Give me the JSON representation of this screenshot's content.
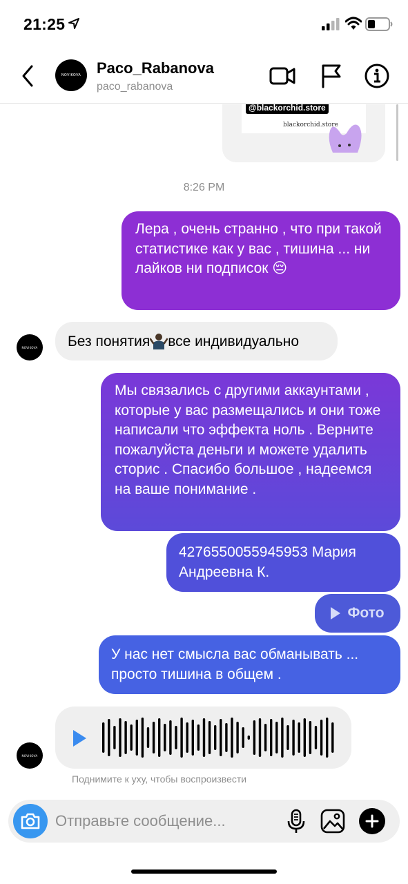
{
  "status_bar": {
    "time": "21:25"
  },
  "header": {
    "display_name": "Paco_Rabanova",
    "username": "paco_rabanova",
    "avatar_text": "NOVIKOVA"
  },
  "story_preview": {
    "tag": "@blackorchid.store",
    "caption": "blackorchid.store"
  },
  "timestamp": "8:26 PM",
  "messages": [
    {
      "from": "me",
      "text": "Лера , очень странно , что при такой статистике как у вас , тишина ... ни лайков ни подписок 😔"
    },
    {
      "from": "them",
      "text_before": "Без понятия",
      "text_after": "все индивидуально"
    },
    {
      "from": "me",
      "text": "Мы связались с другими аккаунтами , которые у вас размещались и они тоже написали что эффекта ноль . Верните пожалуйста деньги и можете удалить сторис . Спасибо большое , надеемся на ваше понимание ."
    },
    {
      "from": "me",
      "text": "4276550055945953 Мария Андреевна К."
    },
    {
      "from": "me",
      "type": "photo",
      "label": "Фото"
    },
    {
      "from": "me",
      "text": "У нас нет смысла вас обманывать ... просто тишина в общем ."
    },
    {
      "from": "them",
      "type": "voice"
    }
  ],
  "voice_hint": "Поднимите к уху, чтобы воспроизвести",
  "composer": {
    "placeholder": "Отправьте сообщение..."
  },
  "colors": {
    "sent_top": "#8d2fd4",
    "sent_bottom": "#4662e3",
    "received": "#efefef",
    "camera_button": "#3897f0",
    "voice_play": "#3a8bef"
  },
  "icons": [
    "navigation-arrow-icon",
    "signal-icon",
    "wifi-icon",
    "battery-icon",
    "back-chevron-icon",
    "video-call-icon",
    "report-flag-icon",
    "info-icon",
    "camera-icon",
    "microphone-icon",
    "gallery-icon",
    "plus-icon",
    "play-icon",
    "shrug-emoji-icon"
  ]
}
